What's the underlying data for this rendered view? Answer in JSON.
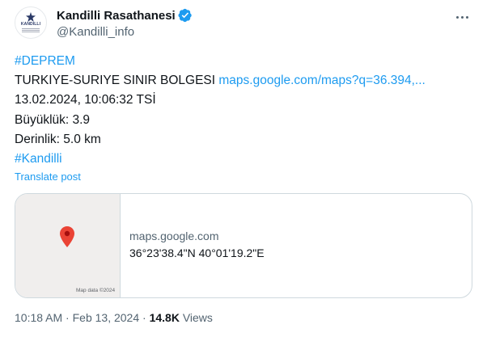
{
  "author": {
    "display_name": "Kandilli Rasathanesi",
    "handle": "@Kandilli_info",
    "logo_text": "KANDILLI"
  },
  "tweet": {
    "hashtag_1": "#DEPREM",
    "location_text": "TURKIYE-SURIYE SINIR BOLGESI",
    "location_link": "maps.google.com/maps?q=36.394,...",
    "datetime_line": "13.02.2024, 10:06:32 TSİ",
    "magnitude_line": "Büyüklük: 3.9",
    "depth_line": "Derinlik: 5.0 km",
    "hashtag_2": "#Kandilli",
    "translate_label": "Translate post"
  },
  "card": {
    "domain": "maps.google.com",
    "coordinates": "36°23'38.4\"N 40°01'19.2\"E",
    "map_credit": "Map data ©2024"
  },
  "meta": {
    "time": "10:18 AM",
    "separator": "·",
    "date": "Feb 13, 2024",
    "views_count": "14.8K",
    "views_label": "Views"
  },
  "icons": {
    "verified": "verified-badge-icon",
    "more": "more-options-icon",
    "pin": "map-pin-icon"
  },
  "colors": {
    "link": "#1d9bf0",
    "muted": "#536471",
    "text": "#0f1419",
    "pin": "#ea4335",
    "map_bg": "#f0eeed"
  }
}
